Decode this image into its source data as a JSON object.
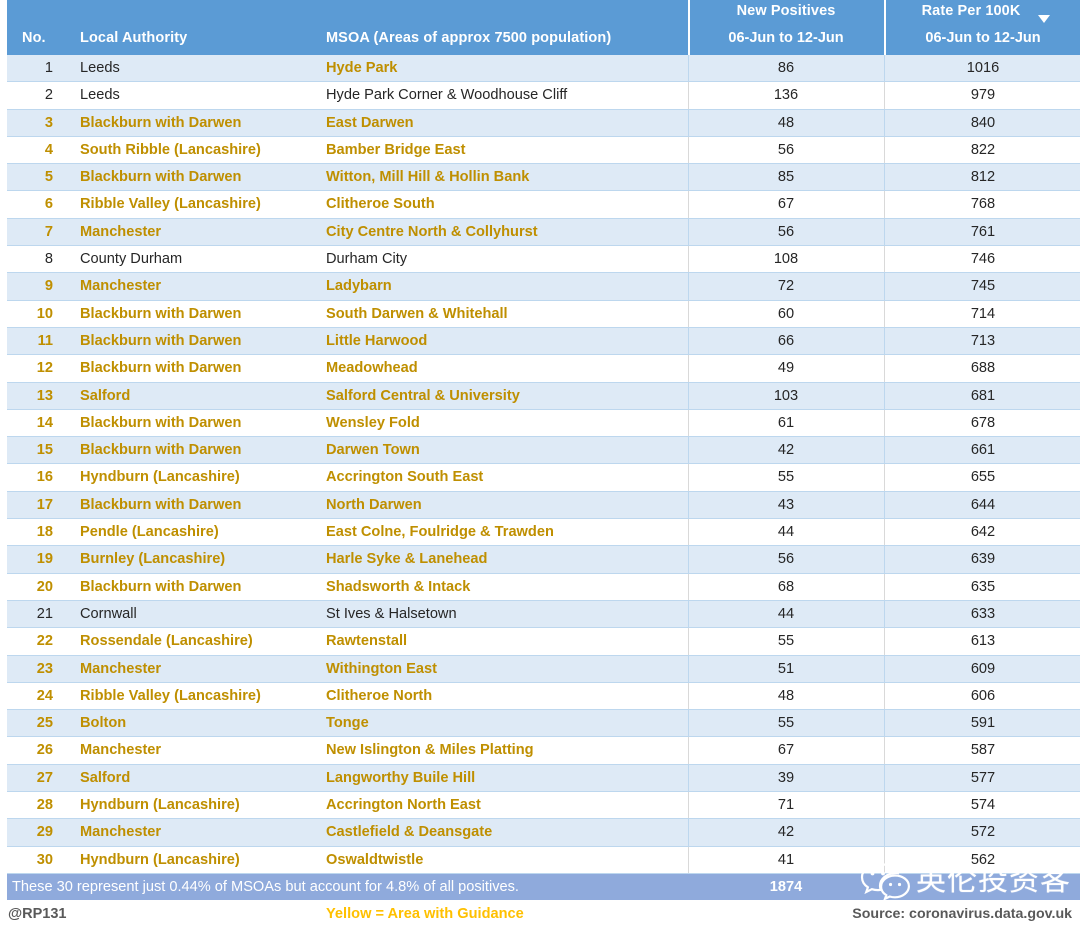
{
  "table": {
    "columns": [
      {
        "key": "no",
        "label": "No.",
        "sub": ""
      },
      {
        "key": "local_authority",
        "label": "Local Authority",
        "sub": ""
      },
      {
        "key": "msoa",
        "label": "MSOA (Areas of approx 7500 population)",
        "sub": ""
      },
      {
        "key": "new_positives",
        "label": "New Positives",
        "sub": "06-Jun to 12-Jun"
      },
      {
        "key": "rate_per_100k",
        "label": "Rate Per 100K",
        "sub": "06-Jun to 12-Jun",
        "sort_icon": "caret-down-icon",
        "sorted": true
      }
    ],
    "rows": [
      {
        "no": "1",
        "local_authority": "Leeds",
        "msoa": "Hyde Park",
        "new_positives": "86",
        "rate_per_100k": "1016",
        "guidance": false,
        "msoa_guidance": true
      },
      {
        "no": "2",
        "local_authority": "Leeds",
        "msoa": "Hyde Park Corner & Woodhouse Cliff",
        "new_positives": "136",
        "rate_per_100k": "979",
        "guidance": false,
        "msoa_guidance": false
      },
      {
        "no": "3",
        "local_authority": "Blackburn with Darwen",
        "msoa": "East Darwen",
        "new_positives": "48",
        "rate_per_100k": "840",
        "guidance": true,
        "msoa_guidance": true
      },
      {
        "no": "4",
        "local_authority": "South Ribble (Lancashire)",
        "msoa": "Bamber Bridge East",
        "new_positives": "56",
        "rate_per_100k": "822",
        "guidance": true,
        "msoa_guidance": true
      },
      {
        "no": "5",
        "local_authority": "Blackburn with Darwen",
        "msoa": "Witton, Mill Hill & Hollin Bank",
        "new_positives": "85",
        "rate_per_100k": "812",
        "guidance": true,
        "msoa_guidance": true
      },
      {
        "no": "6",
        "local_authority": "Ribble Valley (Lancashire)",
        "msoa": "Clitheroe South",
        "new_positives": "67",
        "rate_per_100k": "768",
        "guidance": true,
        "msoa_guidance": true
      },
      {
        "no": "7",
        "local_authority": "Manchester",
        "msoa": "City Centre North & Collyhurst",
        "new_positives": "56",
        "rate_per_100k": "761",
        "guidance": true,
        "msoa_guidance": true
      },
      {
        "no": "8",
        "local_authority": "County Durham",
        "msoa": "Durham City",
        "new_positives": "108",
        "rate_per_100k": "746",
        "guidance": false,
        "msoa_guidance": false
      },
      {
        "no": "9",
        "local_authority": "Manchester",
        "msoa": "Ladybarn",
        "new_positives": "72",
        "rate_per_100k": "745",
        "guidance": true,
        "msoa_guidance": true
      },
      {
        "no": "10",
        "local_authority": "Blackburn with Darwen",
        "msoa": "South Darwen & Whitehall",
        "new_positives": "60",
        "rate_per_100k": "714",
        "guidance": true,
        "msoa_guidance": true
      },
      {
        "no": "11",
        "local_authority": "Blackburn with Darwen",
        "msoa": "Little Harwood",
        "new_positives": "66",
        "rate_per_100k": "713",
        "guidance": true,
        "msoa_guidance": true
      },
      {
        "no": "12",
        "local_authority": "Blackburn with Darwen",
        "msoa": "Meadowhead",
        "new_positives": "49",
        "rate_per_100k": "688",
        "guidance": true,
        "msoa_guidance": true
      },
      {
        "no": "13",
        "local_authority": "Salford",
        "msoa": "Salford Central & University",
        "new_positives": "103",
        "rate_per_100k": "681",
        "guidance": true,
        "msoa_guidance": true
      },
      {
        "no": "14",
        "local_authority": "Blackburn with Darwen",
        "msoa": "Wensley Fold",
        "new_positives": "61",
        "rate_per_100k": "678",
        "guidance": true,
        "msoa_guidance": true
      },
      {
        "no": "15",
        "local_authority": "Blackburn with Darwen",
        "msoa": "Darwen Town",
        "new_positives": "42",
        "rate_per_100k": "661",
        "guidance": true,
        "msoa_guidance": true
      },
      {
        "no": "16",
        "local_authority": "Hyndburn (Lancashire)",
        "msoa": "Accrington South East",
        "new_positives": "55",
        "rate_per_100k": "655",
        "guidance": true,
        "msoa_guidance": true
      },
      {
        "no": "17",
        "local_authority": "Blackburn with Darwen",
        "msoa": "North Darwen",
        "new_positives": "43",
        "rate_per_100k": "644",
        "guidance": true,
        "msoa_guidance": true
      },
      {
        "no": "18",
        "local_authority": "Pendle (Lancashire)",
        "msoa": "East Colne, Foulridge & Trawden",
        "new_positives": "44",
        "rate_per_100k": "642",
        "guidance": true,
        "msoa_guidance": true
      },
      {
        "no": "19",
        "local_authority": "Burnley (Lancashire)",
        "msoa": "Harle Syke & Lanehead",
        "new_positives": "56",
        "rate_per_100k": "639",
        "guidance": true,
        "msoa_guidance": true
      },
      {
        "no": "20",
        "local_authority": "Blackburn with Darwen",
        "msoa": "Shadsworth & Intack",
        "new_positives": "68",
        "rate_per_100k": "635",
        "guidance": true,
        "msoa_guidance": true
      },
      {
        "no": "21",
        "local_authority": "Cornwall",
        "msoa": "St Ives & Halsetown",
        "new_positives": "44",
        "rate_per_100k": "633",
        "guidance": false,
        "msoa_guidance": false
      },
      {
        "no": "22",
        "local_authority": "Rossendale (Lancashire)",
        "msoa": "Rawtenstall",
        "new_positives": "55",
        "rate_per_100k": "613",
        "guidance": true,
        "msoa_guidance": true
      },
      {
        "no": "23",
        "local_authority": "Manchester",
        "msoa": "Withington East",
        "new_positives": "51",
        "rate_per_100k": "609",
        "guidance": true,
        "msoa_guidance": true
      },
      {
        "no": "24",
        "local_authority": "Ribble Valley (Lancashire)",
        "msoa": "Clitheroe North",
        "new_positives": "48",
        "rate_per_100k": "606",
        "guidance": true,
        "msoa_guidance": true
      },
      {
        "no": "25",
        "local_authority": "Bolton",
        "msoa": "Tonge",
        "new_positives": "55",
        "rate_per_100k": "591",
        "guidance": true,
        "msoa_guidance": true
      },
      {
        "no": "26",
        "local_authority": "Manchester",
        "msoa": "New Islington & Miles Platting",
        "new_positives": "67",
        "rate_per_100k": "587",
        "guidance": true,
        "msoa_guidance": true
      },
      {
        "no": "27",
        "local_authority": "Salford",
        "msoa": "Langworthy Buile Hill",
        "new_positives": "39",
        "rate_per_100k": "577",
        "guidance": true,
        "msoa_guidance": true
      },
      {
        "no": "28",
        "local_authority": "Hyndburn (Lancashire)",
        "msoa": "Accrington North East",
        "new_positives": "71",
        "rate_per_100k": "574",
        "guidance": true,
        "msoa_guidance": true
      },
      {
        "no": "29",
        "local_authority": "Manchester",
        "msoa": "Castlefield & Deansgate",
        "new_positives": "42",
        "rate_per_100k": "572",
        "guidance": true,
        "msoa_guidance": true
      },
      {
        "no": "30",
        "local_authority": "Hyndburn (Lancashire)",
        "msoa": "Oswaldtwistle",
        "new_positives": "41",
        "rate_per_100k": "562",
        "guidance": true,
        "msoa_guidance": true
      }
    ]
  },
  "summary": {
    "text": "These 30 represent just 0.44% of MSOAs but account for 4.8% of all positives.",
    "total_new_positives": "1874"
  },
  "footer": {
    "handle": "@RP131",
    "legend": "Yellow = Area with Guidance",
    "source": "Source: coronavirus.data.gov.uk"
  },
  "watermark": {
    "text": "英伦投资客",
    "icon": "wechat-icon"
  },
  "colors": {
    "header_blue": "#5B9BD5",
    "row_stripe": "#DEEAF6",
    "guidance_gold": "#BF8F00",
    "legend_yellow": "#FFC000",
    "summary_blue": "#8FAADC",
    "grid_line": "#BDD7EE",
    "text_dark": "#262626"
  }
}
